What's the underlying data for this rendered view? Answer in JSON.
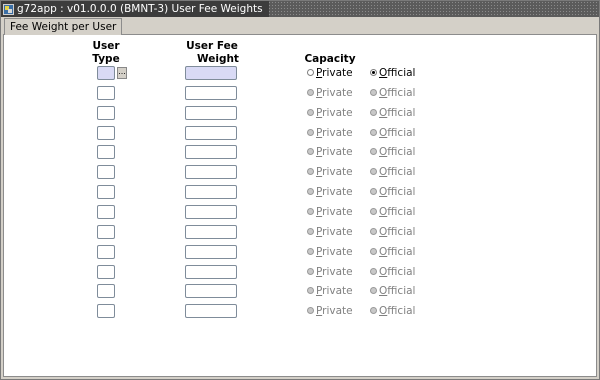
{
  "window": {
    "title": "g72app : v01.0.0.0 (BMNT-3) User Fee Weights"
  },
  "tab": {
    "label": "Fee Weight per User"
  },
  "headers": {
    "user_type": [
      "User",
      "Type"
    ],
    "user_fee_weight": [
      "User Fee",
      "Weight"
    ],
    "capacity": "Capacity"
  },
  "lov_button": "...",
  "rows": [
    {
      "user_type": "",
      "weight": "",
      "capacity": "Official",
      "enabled": true
    },
    {
      "user_type": "",
      "weight": "",
      "capacity": "",
      "enabled": false
    },
    {
      "user_type": "",
      "weight": "",
      "capacity": "",
      "enabled": false
    },
    {
      "user_type": "",
      "weight": "",
      "capacity": "",
      "enabled": false
    },
    {
      "user_type": "",
      "weight": "",
      "capacity": "",
      "enabled": false
    },
    {
      "user_type": "",
      "weight": "",
      "capacity": "",
      "enabled": false
    },
    {
      "user_type": "",
      "weight": "",
      "capacity": "",
      "enabled": false
    },
    {
      "user_type": "",
      "weight": "",
      "capacity": "",
      "enabled": false
    },
    {
      "user_type": "",
      "weight": "",
      "capacity": "",
      "enabled": false
    },
    {
      "user_type": "",
      "weight": "",
      "capacity": "",
      "enabled": false
    },
    {
      "user_type": "",
      "weight": "",
      "capacity": "",
      "enabled": false
    },
    {
      "user_type": "",
      "weight": "",
      "capacity": "",
      "enabled": false
    },
    {
      "user_type": "",
      "weight": "",
      "capacity": "",
      "enabled": false
    }
  ],
  "radio_options": {
    "private": "Private",
    "official": "Official"
  },
  "colors": {
    "active_field": "#d9daf5",
    "disabled_text": "#808080",
    "title_bar": "#5b5b5b"
  }
}
